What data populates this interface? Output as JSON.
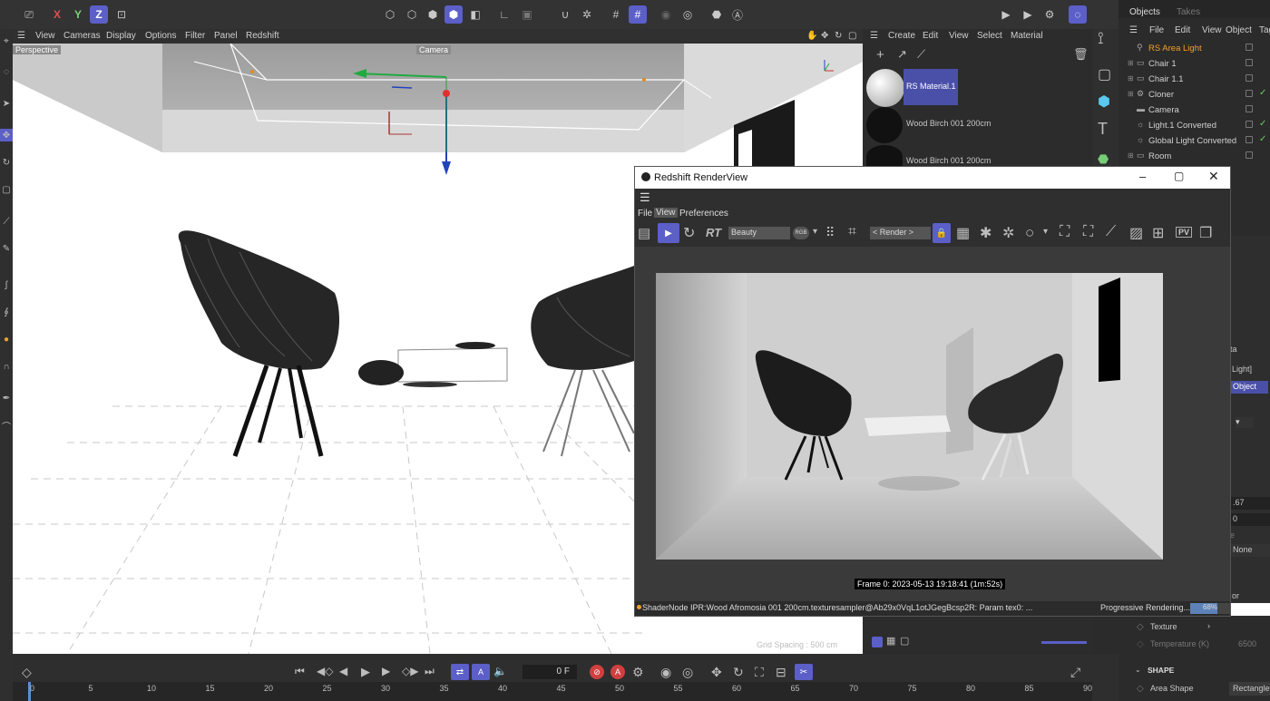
{
  "top_toolbar": {
    "axis_x": "X",
    "axis_y": "Y",
    "axis_z": "Z"
  },
  "viewport": {
    "menu": [
      "View",
      "Cameras",
      "Display",
      "Options",
      "Filter",
      "Panel",
      "Redshift"
    ],
    "label": "Perspective",
    "camera_label": "Camera",
    "grid_spacing": "Grid Spacing : 500 cm"
  },
  "material_panel": {
    "menu": [
      "Create",
      "Edit",
      "View",
      "Select",
      "Material"
    ],
    "materials": [
      {
        "name": "RS Material.1",
        "selected": true
      },
      {
        "name": "Wood Birch 001 200cm",
        "selected": false
      },
      {
        "name": "Wood Birch 001 200cm",
        "selected": false
      }
    ]
  },
  "objects_panel": {
    "tabs": [
      "Objects",
      "Takes"
    ],
    "menu": [
      "File",
      "Edit",
      "View",
      "Object",
      "Tag"
    ],
    "items": [
      {
        "name": "RS Area Light",
        "highlight": true
      },
      {
        "name": "Chair 1",
        "highlight": false
      },
      {
        "name": "Chair 1.1",
        "highlight": false
      },
      {
        "name": "Cloner",
        "highlight": false
      },
      {
        "name": "Camera",
        "highlight": false
      },
      {
        "name": "Light.1 Converted",
        "highlight": false
      },
      {
        "name": "Global Light Converted",
        "highlight": false
      },
      {
        "name": "Room",
        "highlight": false
      }
    ]
  },
  "attributes": {
    "partial_ta": "ta",
    "partial_light": "Light]",
    "object_button": "Object",
    "value_67": ".67",
    "value_0": "0",
    "value_e": "e",
    "none": "None",
    "partial_or": "or",
    "texture_label": "Texture",
    "temperature_label": "Temperature (K)",
    "temperature_value": "6500",
    "shape_section": "SHAPE",
    "area_shape_label": "Area Shape",
    "area_shape_value": "Rectangle"
  },
  "render_view": {
    "title": "Redshift RenderView",
    "menu": [
      "File",
      "View",
      "Preferences"
    ],
    "active_menu": "View",
    "rt_label": "RT",
    "aov_select": "Beauty",
    "rgb_label": "RGB",
    "render_select": "< Render >",
    "pv_label": "PV",
    "frame_info": "Frame  0:  2023-05-13  19:18:41  (1m:52s)",
    "status_text": "ShaderNode IPR:Wood Afromosia 001 200cm.texturesampler@Ab29x0VqL1otJGegBcsp2R: Param tex0: ...",
    "progress_label": "Progressive Rendering...",
    "progress_value": "68%",
    "progress_fraction": 0.68
  },
  "timeline": {
    "current_frame": "0 F",
    "ticks": [
      "0",
      "5",
      "10",
      "15",
      "20",
      "25",
      "30",
      "35",
      "40",
      "45",
      "50",
      "55",
      "60",
      "65",
      "70",
      "75",
      "80",
      "85",
      "90"
    ]
  },
  "colors": {
    "accent": "#5b5fc7",
    "highlight_orange": "#f0a030",
    "record_red": "#d04040"
  }
}
